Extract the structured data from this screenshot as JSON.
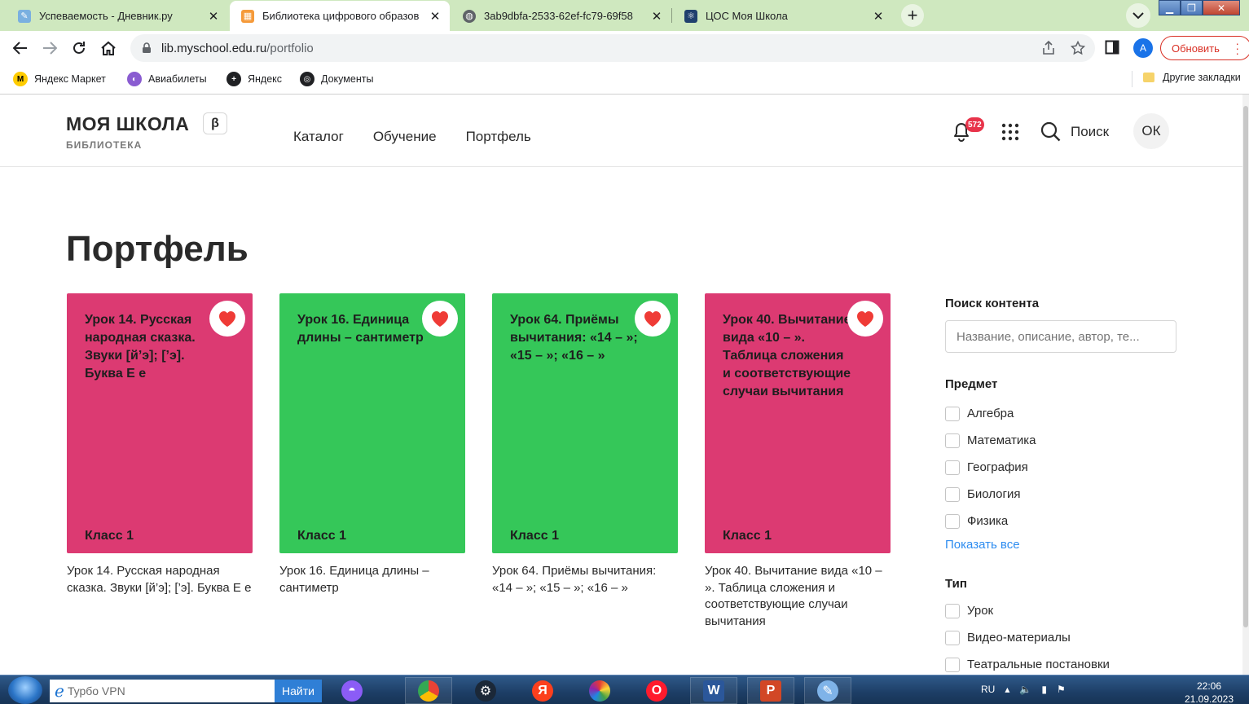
{
  "browser": {
    "tabs": [
      {
        "title": "Успеваемость - Дневник.ру",
        "active": false
      },
      {
        "title": "Библиотека цифрового образов",
        "active": true
      },
      {
        "title": "3ab9dbfa-2533-62ef-fc79-69f58",
        "active": false
      },
      {
        "title": "ЦОС Моя Школа",
        "active": false
      }
    ],
    "url_host": "lib.myschool.edu.ru",
    "url_path": "/portfolio",
    "profile_initial": "A",
    "update_label": "Обновить",
    "bookmarks": [
      {
        "label": "Яндекс Маркет"
      },
      {
        "label": "Авиабилеты"
      },
      {
        "label": "Яндекс"
      },
      {
        "label": "Документы"
      }
    ],
    "other_bookmarks": "Другие закладки"
  },
  "site": {
    "logo": "МОЯ ШКОЛА",
    "beta": "β",
    "logo_sub": "БИБЛИОТЕКА",
    "nav": [
      "Каталог",
      "Обучение",
      "Портфель"
    ],
    "notifications_count": "572",
    "search_label": "Поиск",
    "user_initials": "ОК"
  },
  "page": {
    "title": "Портфель",
    "cards": [
      {
        "cover_title": "Урок 14. Русская народная сказка. Звуки [й’э]; [’э]. Буква Е е",
        "grade": "Класс 1",
        "caption": "Урок 14. Русская народная сказка. Звуки [й’э]; [’э]. Буква Е е",
        "color": "#dc3a72"
      },
      {
        "cover_title": "Урок 16. Единица длины – сантиметр",
        "grade": "Класс 1",
        "caption": "Урок 16. Единица длины – сантиметр",
        "color": "#35c759"
      },
      {
        "cover_title": "Урок 64. Приёмы вычитания: «14 – »; «15 – »; «16 – »",
        "grade": "Класс 1",
        "caption": "Урок 64. Приёмы вычитания: «14 – »; «15 – »; «16 – »",
        "color": "#35c759"
      },
      {
        "cover_title": "Урок 40. Вычитание вида «10 – ». Таблица сложения и соответствующие случаи вычитания",
        "grade": "Класс 1",
        "caption": "Урок 40. Вычитание вида «10 – ». Таблица сложения и соответствующие случаи вычитания",
        "color": "#dc3a72"
      }
    ],
    "filters": {
      "search_title": "Поиск контента",
      "search_placeholder": "Название, описание, автор, те...",
      "subject_title": "Предмет",
      "subjects": [
        "Алгебра",
        "Математика",
        "География",
        "Биология",
        "Физика"
      ],
      "show_all": "Показать все",
      "type_title": "Тип",
      "types": [
        "Урок",
        "Видео-материалы",
        "Театральные постановки"
      ]
    }
  },
  "taskbar": {
    "search_text": "Турбо VPN",
    "find_label": "Найти",
    "lang": "RU",
    "time": "22:06",
    "date": "21.09.2023"
  },
  "colors": {
    "accent_link": "#2d8cf0",
    "heart": "#ef3b36",
    "badge": "#e8334a"
  }
}
